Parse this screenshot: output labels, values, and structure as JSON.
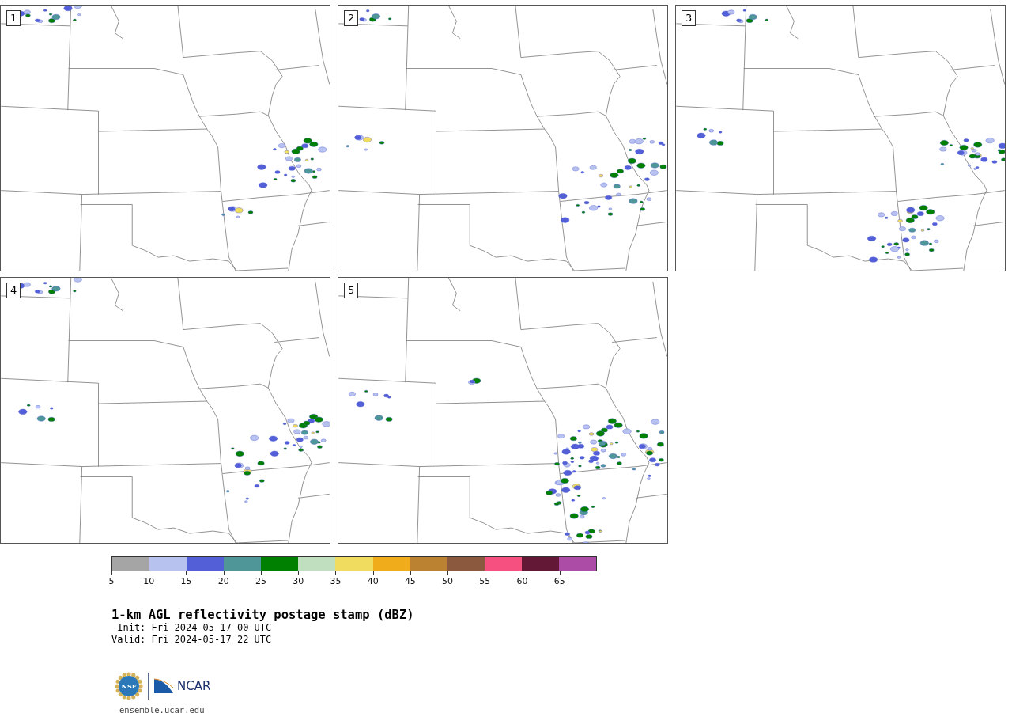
{
  "panels": [
    {
      "label": "1"
    },
    {
      "label": "2"
    },
    {
      "label": "3"
    },
    {
      "label": "4"
    },
    {
      "label": "5"
    }
  ],
  "colorbar": {
    "segments": [
      {
        "color": "#a5a5a5"
      },
      {
        "color": "#b8c2ee"
      },
      {
        "color": "#525fd6"
      },
      {
        "color": "#4f9699"
      },
      {
        "color": "#008000"
      },
      {
        "color": "#bfdfbf"
      },
      {
        "color": "#f0dc5e"
      },
      {
        "color": "#f0ac1a"
      },
      {
        "color": "#ba8231"
      },
      {
        "color": "#8b5a3e"
      },
      {
        "color": "#f55080"
      },
      {
        "color": "#631836"
      },
      {
        "color": "#ad4ca6"
      }
    ],
    "ticks": [
      "5",
      "10",
      "15",
      "20",
      "25",
      "30",
      "35",
      "40",
      "45",
      "50",
      "55",
      "60",
      "65"
    ]
  },
  "title": "1-km AGL reflectivity postage stamp (dBZ)",
  "init": "Init: Fri 2024-05-17 00 UTC",
  "valid": "Valid: Fri 2024-05-17 22 UTC",
  "logos": {
    "nsf": "NSF",
    "ncar": "NCAR"
  },
  "footer_link": "ensemble.ucar.edu"
}
